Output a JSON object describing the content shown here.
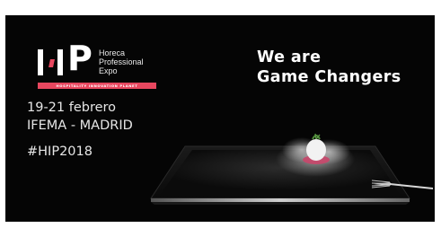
{
  "logo": {
    "line1": "Horeca",
    "line2": "Professional",
    "line3": "Expo",
    "tagline": "HOSPITALITY INNOVATION PLANET",
    "letters": "P"
  },
  "event": {
    "dates": "19-21 febrero",
    "venue": "IFEMA - MADRID",
    "hashtag": "#HIP2018"
  },
  "headline": {
    "line1": "We are",
    "line2": "Game Changers"
  },
  "colors": {
    "background": "#050505",
    "accent": "#e8475f",
    "text": "#ffffff"
  }
}
